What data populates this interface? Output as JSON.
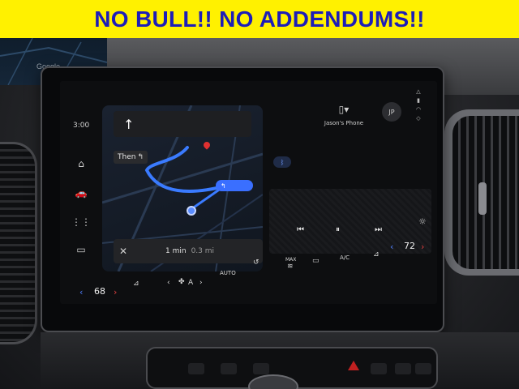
{
  "banner": {
    "text": "NO BULL!! NO ADDENDUMS!!",
    "bg_color": "#fff100",
    "text_color": "#1d1db8"
  },
  "cluster": {
    "map_logo": "Google"
  },
  "screen": {
    "time": "3:00",
    "nav_rail": [
      {
        "icon": "home-icon"
      },
      {
        "icon": "car-icon"
      },
      {
        "icon": "apps-grid-icon"
      },
      {
        "icon": "radio-icon"
      }
    ],
    "navigation": {
      "turn_arrow": "↑",
      "then_label": "Then",
      "then_arrow": "↰",
      "eta": "1 min",
      "distance": "0.3 mi",
      "close_icon": "✕",
      "route_color": "#3a7bff"
    },
    "phone": {
      "icon": "phone-icon",
      "name": "Jason's Phone"
    },
    "profile": {
      "initials": "JP"
    },
    "media": {
      "prev": "⏮",
      "pause": "⏸",
      "next": "⏭"
    },
    "climate": {
      "driver_temp": "68",
      "passenger_temp": "72",
      "auto_label": "AUTO",
      "max_label": "MAX",
      "ac_label": "A/C",
      "fan_label": "A"
    }
  }
}
